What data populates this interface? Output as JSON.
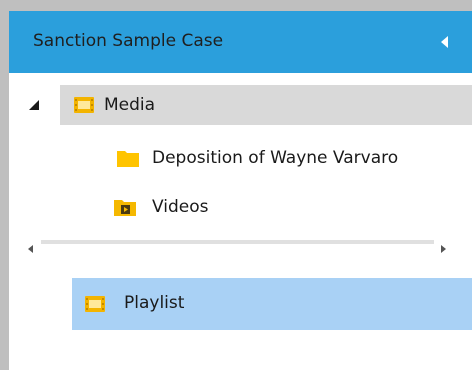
{
  "panel": {
    "title": "Sanction Sample Case",
    "header_color": "#2b9fdc",
    "collapse_icon": "triangle-left-icon"
  },
  "tree": {
    "root": {
      "label": "Media",
      "icon": "film-folder-icon",
      "expanded": true
    },
    "children": [
      {
        "label": "Deposition of Wayne Varvaro",
        "icon": "folder-icon"
      },
      {
        "label": "Videos",
        "icon": "video-folder-icon"
      }
    ]
  },
  "playlist": {
    "label": "Playlist",
    "icon": "film-icon",
    "selected": true,
    "highlight_color": "#a9d1f5"
  }
}
